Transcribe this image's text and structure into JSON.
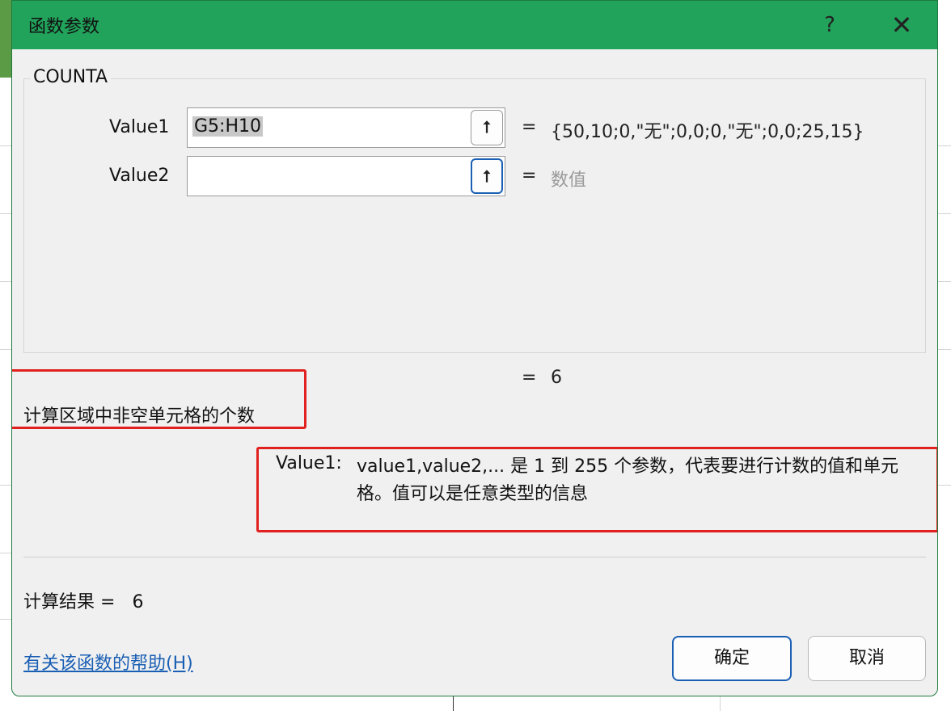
{
  "window": {
    "title": "函数参数",
    "help_glyph": "?",
    "close_glyph": "✕"
  },
  "function": {
    "name": "COUNTA"
  },
  "args": [
    {
      "label": "Value1",
      "value": "G5:H10",
      "eq": "=",
      "preview": "{50,10;0,\"无\";0,0;0,\"无\";0,0;25,15}"
    },
    {
      "label": "Value2",
      "value": "",
      "eq": "=",
      "preview": "数值"
    }
  ],
  "collapse_glyph": "⭡",
  "formula_result": {
    "eq": "=",
    "value": "6"
  },
  "description": "计算区域中非空单元格的个数",
  "arg_description": {
    "label": "Value1:",
    "text": "value1,value2,... 是 1 到 255 个参数，代表要进行计数的值和单元格。值可以是任意类型的信息"
  },
  "result": {
    "label": "计算结果 =",
    "value": "6"
  },
  "help_link": "有关该函数的帮助(H)",
  "buttons": {
    "ok": "确定",
    "cancel": "取消"
  },
  "colors": {
    "titlebar": "#21a35b",
    "highlight": "#e0211f",
    "link": "#1a5fb4"
  }
}
